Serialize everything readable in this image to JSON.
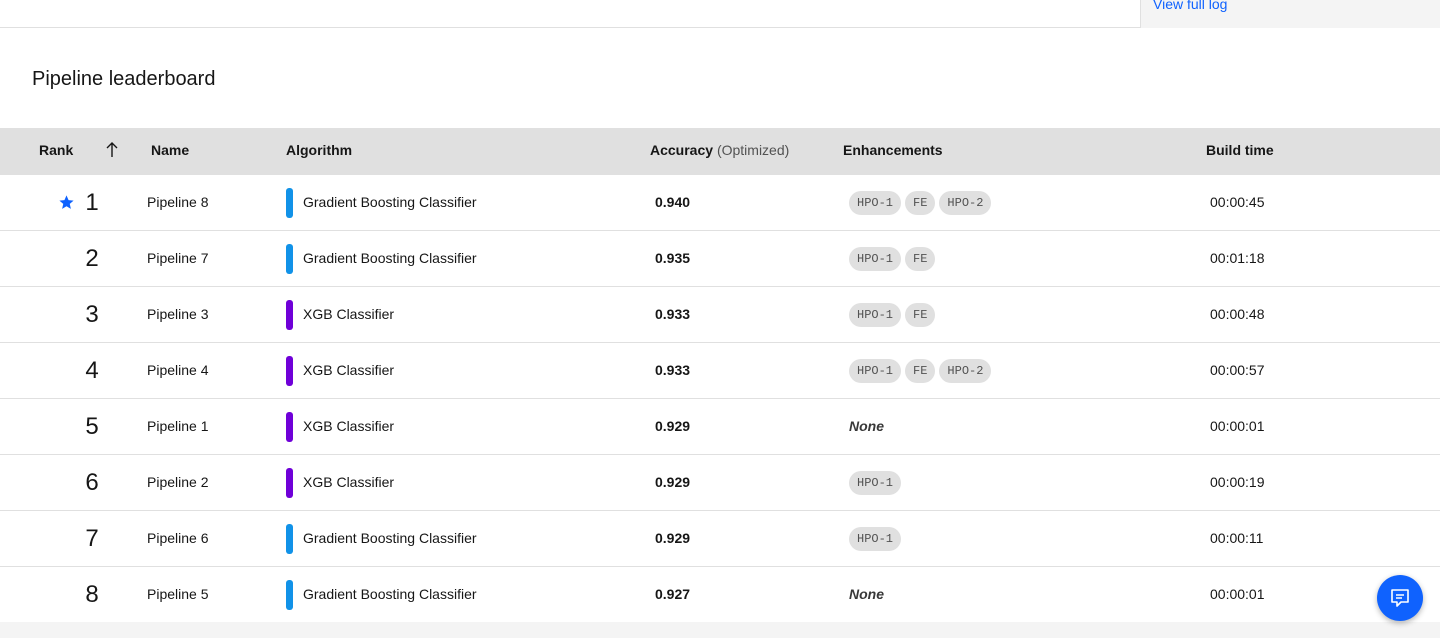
{
  "log": {
    "link": "View full log"
  },
  "page": {
    "title": "Pipeline leaderboard"
  },
  "table": {
    "headers": {
      "rank": "Rank",
      "name": "Name",
      "algorithm": "Algorithm",
      "accuracy": "Accuracy",
      "accuracy_note": "(Optimized)",
      "enhancements": "Enhancements",
      "build_time": "Build time"
    },
    "sort": {
      "column": "Rank",
      "direction": "ascending",
      "icon": "arrow-up-icon"
    },
    "rows": [
      {
        "rank": "1",
        "starred": true,
        "name": "Pipeline 8",
        "algorithm": "Gradient Boosting Classifier",
        "accuracy": "0.940",
        "enhancements": [
          "HPO-1",
          "FE",
          "HPO-2"
        ],
        "none_label": "",
        "build_time": "00:00:45"
      },
      {
        "rank": "2",
        "starred": false,
        "name": "Pipeline 7",
        "algorithm": "Gradient Boosting Classifier",
        "accuracy": "0.935",
        "enhancements": [
          "HPO-1",
          "FE"
        ],
        "none_label": "",
        "build_time": "00:01:18"
      },
      {
        "rank": "3",
        "starred": false,
        "name": "Pipeline 3",
        "algorithm": "XGB Classifier",
        "accuracy": "0.933",
        "enhancements": [
          "HPO-1",
          "FE"
        ],
        "none_label": "",
        "build_time": "00:00:48"
      },
      {
        "rank": "4",
        "starred": false,
        "name": "Pipeline 4",
        "algorithm": "XGB Classifier",
        "accuracy": "0.933",
        "enhancements": [
          "HPO-1",
          "FE",
          "HPO-2"
        ],
        "none_label": "",
        "build_time": "00:00:57"
      },
      {
        "rank": "5",
        "starred": false,
        "name": "Pipeline 1",
        "algorithm": "XGB Classifier",
        "accuracy": "0.929",
        "enhancements": [],
        "none_label": "None",
        "build_time": "00:00:01"
      },
      {
        "rank": "6",
        "starred": false,
        "name": "Pipeline 2",
        "algorithm": "XGB Classifier",
        "accuracy": "0.929",
        "enhancements": [
          "HPO-1"
        ],
        "none_label": "",
        "build_time": "00:00:19"
      },
      {
        "rank": "7",
        "starred": false,
        "name": "Pipeline 6",
        "algorithm": "Gradient Boosting Classifier",
        "accuracy": "0.929",
        "enhancements": [
          "HPO-1"
        ],
        "none_label": "",
        "build_time": "00:00:11"
      },
      {
        "rank": "8",
        "starred": false,
        "name": "Pipeline 5",
        "algorithm": "Gradient Boosting Classifier",
        "accuracy": "0.927",
        "enhancements": [],
        "none_label": "None",
        "build_time": "00:00:01"
      }
    ]
  },
  "colors": {
    "accent": "#0f62fe",
    "Gradient Boosting Classifier": "#1192e8",
    "XGB Classifier": "#6f00d8",
    "header_bg": "#e0e0e0"
  },
  "icons": {
    "star": "star-icon",
    "chat": "chat-icon"
  }
}
